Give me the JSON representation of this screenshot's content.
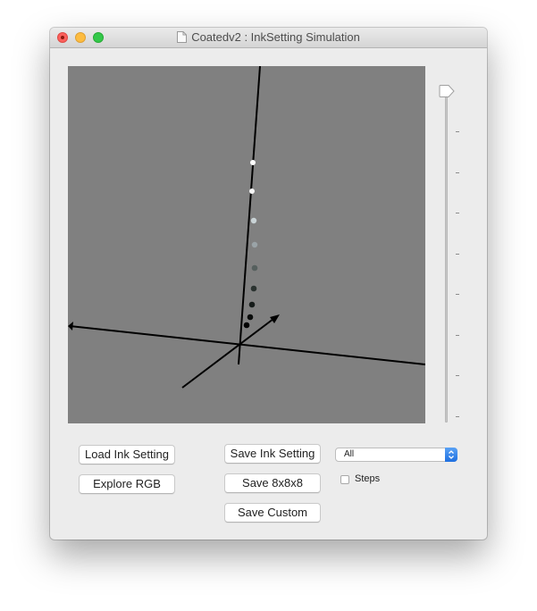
{
  "window": {
    "title": "Coatedv2 : InkSetting Simulation"
  },
  "buttons": {
    "load_ink": "Load Ink Setting",
    "explore_rgb": "Explore RGB",
    "save_ink": "Save Ink Setting",
    "save_8x8x8": "Save 8x8x8",
    "save_custom": "Save Custom"
  },
  "popup": {
    "selected": "All"
  },
  "steps_checkbox": {
    "label": "Steps",
    "checked": false
  },
  "slider": {
    "value_fraction": 0.0,
    "tick_count": 8
  },
  "viewport": {
    "background": "#808080"
  },
  "icons": {
    "close": "close-dot",
    "minimize": "minimize-dot",
    "zoom": "zoom-dot",
    "document": "document-icon",
    "popup_arrows": "updown-chevron-icon"
  }
}
